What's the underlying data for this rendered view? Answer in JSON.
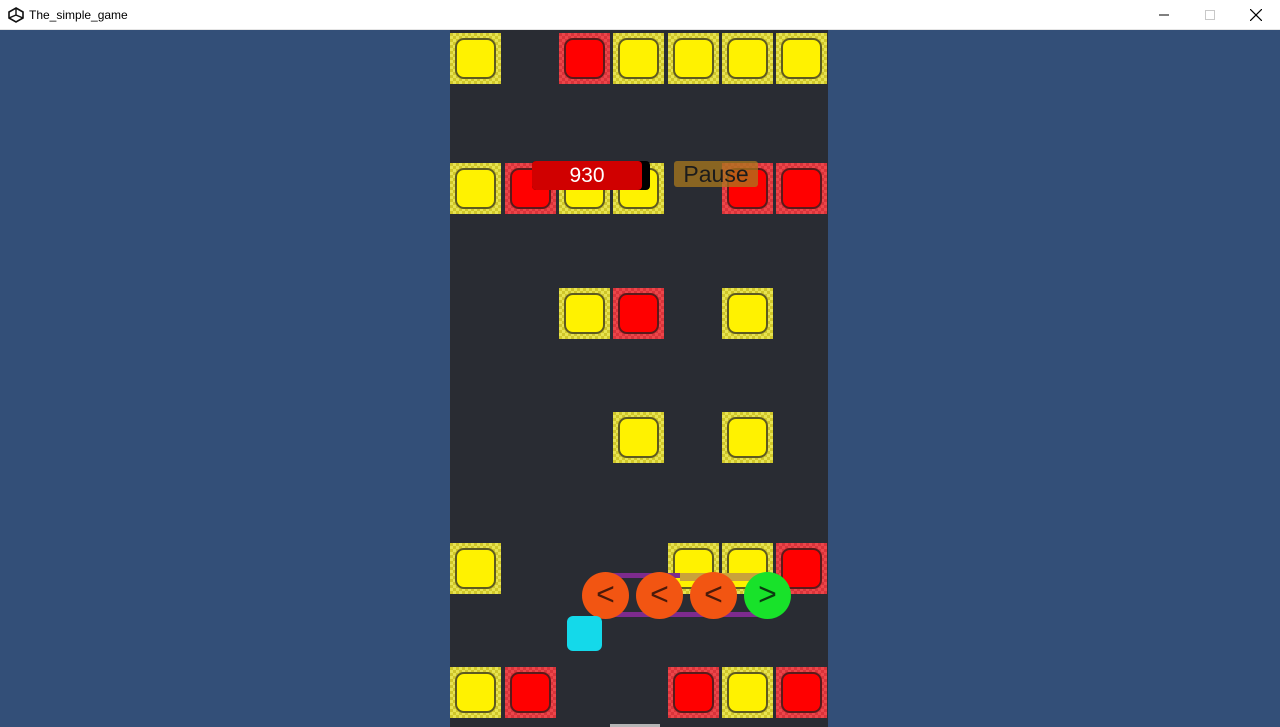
{
  "window": {
    "title": "The_simple_game",
    "controls": [
      "minimize",
      "maximize",
      "close"
    ]
  },
  "hud": {
    "score": "930",
    "score_fill_fraction": 0.93,
    "pause_label": "Pause"
  },
  "controls": {
    "buttons": [
      {
        "label": "<",
        "color": "#f25512"
      },
      {
        "label": "<",
        "color": "#f25512"
      },
      {
        "label": "<",
        "color": "#f25512"
      },
      {
        "label": ">",
        "color": "#18e22a"
      }
    ]
  },
  "board": {
    "columns": 7,
    "colors": {
      "yellow": "#fff200",
      "red": "#ff0000",
      "player": "#14d9ea",
      "background": "#292c33"
    },
    "rows": [
      [
        "yellow",
        null,
        "red",
        "yellow",
        "yellow",
        "yellow",
        "yellow"
      ],
      [
        "yellow",
        "red",
        "yellow",
        "yellow",
        null,
        "red",
        "red"
      ],
      [
        null,
        null,
        "yellow",
        "red",
        null,
        "yellow",
        null
      ],
      [
        null,
        null,
        null,
        "yellow",
        null,
        "yellow",
        null
      ],
      [
        "yellow",
        null,
        null,
        null,
        "yellow",
        "yellow",
        "red"
      ],
      [
        "yellow",
        "red",
        null,
        null,
        "red",
        "yellow",
        "red"
      ]
    ]
  }
}
